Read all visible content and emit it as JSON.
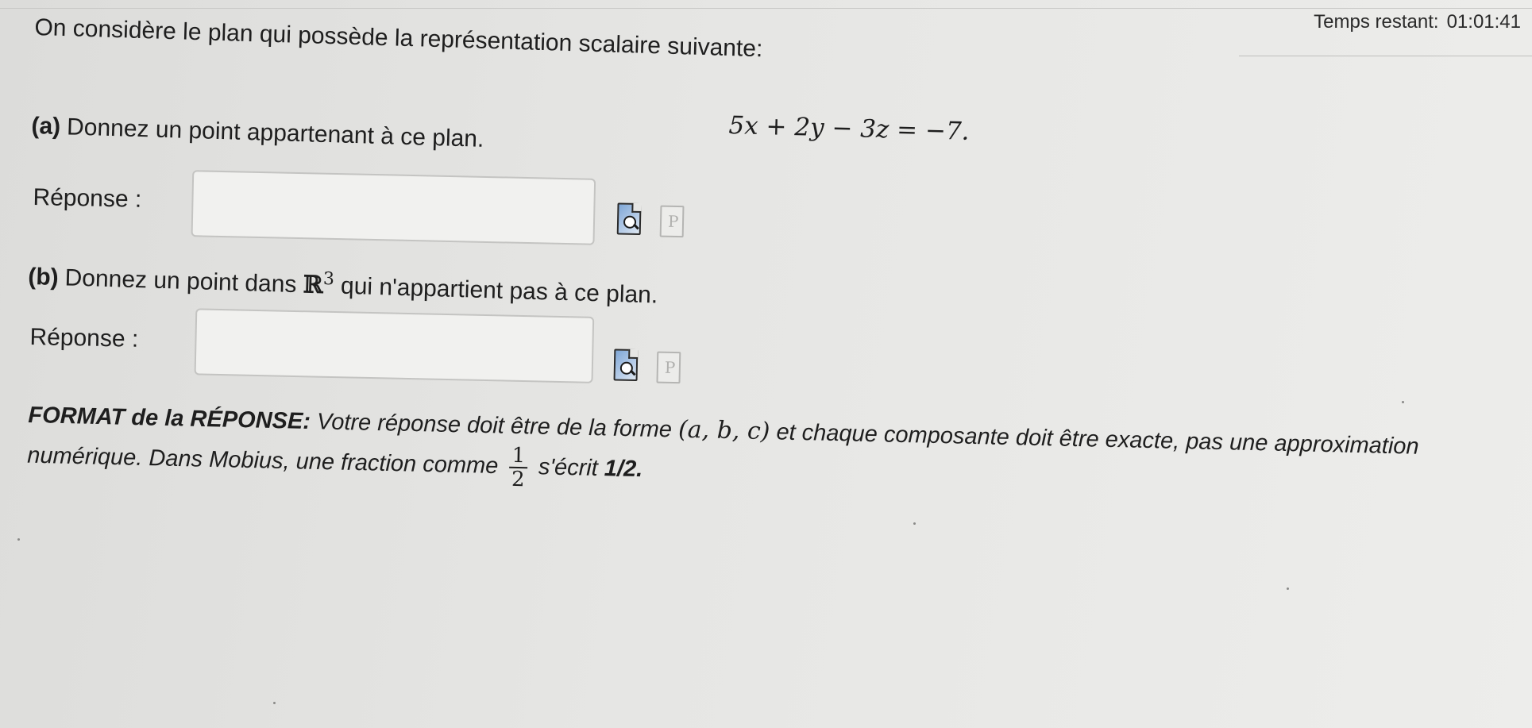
{
  "timer": {
    "label": "Temps restant:",
    "value": "01:01:41"
  },
  "intro": {
    "text": "On considère le plan qui possède la représentation scalaire suivante:",
    "equation": "5x + 2y − 3z = −7."
  },
  "questions": [
    {
      "tag": "(a)",
      "text": "Donnez un point appartenant à ce plan.",
      "answer_label": "Réponse :",
      "answer_value": ""
    },
    {
      "tag": "(b)",
      "text_before": "Donnez un point dans",
      "math_symbol": "ℝ",
      "math_exponent": "3",
      "text_after": "qui n'appartient pas à ce plan.",
      "answer_label": "Réponse :",
      "answer_value": ""
    }
  ],
  "format": {
    "label": "FORMAT de la RÉPONSE:",
    "text_1": "Votre réponse doit être de la forme",
    "tuple": "(a, b, c)",
    "text_2": "et chaque composante doit être exacte, pas une approximation numérique.  Dans Mobius, une fraction comme",
    "fraction_num": "1",
    "fraction_den": "2",
    "text_3": "s'écrit",
    "code": "1/2."
  },
  "icons": {
    "preview": "preview-magnifier-icon",
    "hint": "hint-p-icon"
  }
}
